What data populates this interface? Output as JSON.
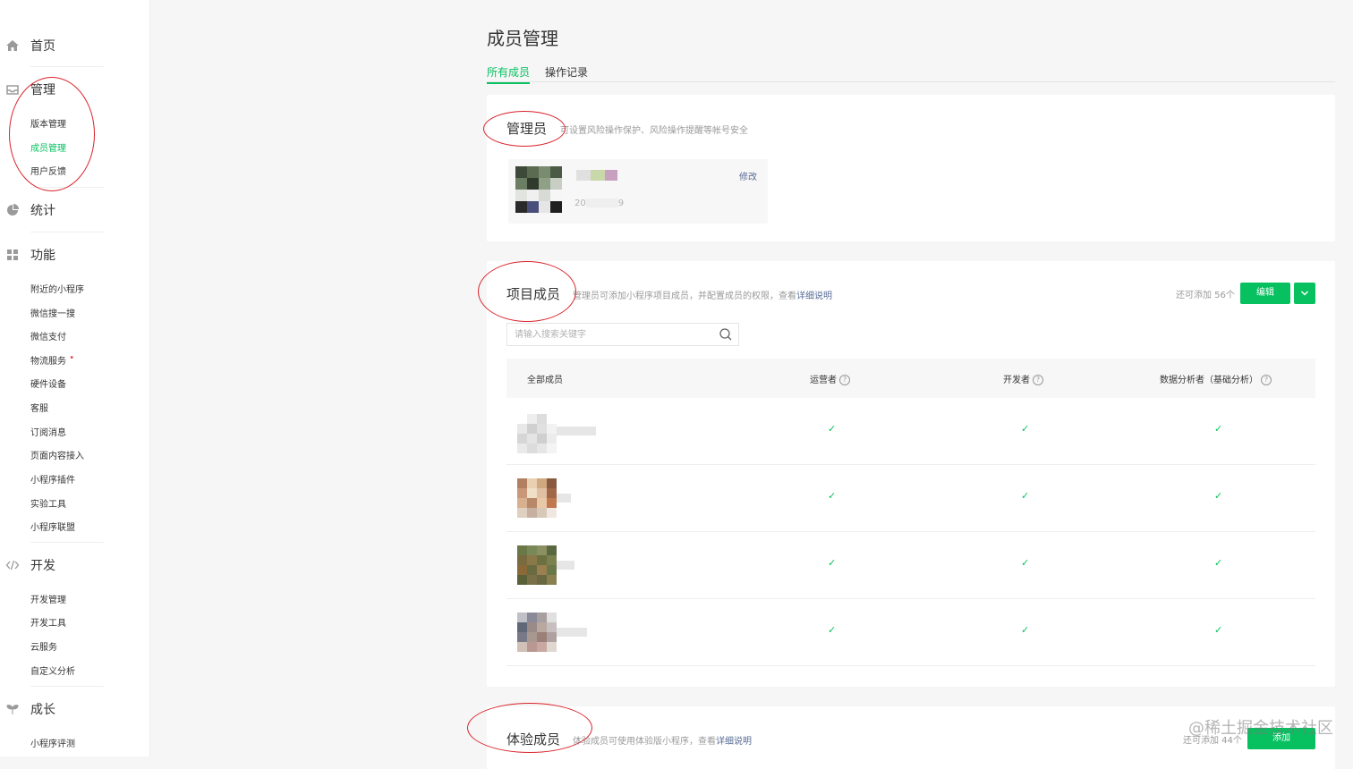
{
  "sidebar": {
    "home": "首页",
    "manage": {
      "label": "管理",
      "items": [
        "版本管理",
        "成员管理",
        "用户反馈"
      ],
      "active_index": 1
    },
    "stats": "统计",
    "features": {
      "label": "功能",
      "items": [
        "附近的小程序",
        "微信搜一搜",
        "微信支付",
        "物流服务",
        "硬件设备",
        "客服",
        "订阅消息",
        "页面内容接入",
        "小程序插件",
        "实验工具",
        "小程序联盟"
      ]
    },
    "dev": {
      "label": "开发",
      "items": [
        "开发管理",
        "开发工具",
        "云服务",
        "自定义分析"
      ]
    },
    "growth": {
      "label": "成长",
      "items": [
        "小程序评测"
      ]
    }
  },
  "page": {
    "title": "成员管理",
    "tabs": [
      "所有成员",
      "操作记录"
    ]
  },
  "admin": {
    "title": "管理员",
    "desc": "可设置风险操作保护、风险操作提醒等帐号安全",
    "edit": "修改",
    "id_prefix": "20",
    "id_suffix": "9"
  },
  "project": {
    "title": "项目成员",
    "desc": "管理员可添加小程序项目成员，并配置成员的权限，查看",
    "desc_link": "详细说明",
    "remaining": "还可添加 56个",
    "edit_btn": "编辑",
    "search_placeholder": "请输入搜索关键字",
    "columns": [
      "全部成员",
      "运营者",
      "开发者",
      "数据分析者（基础分析）"
    ],
    "check": "✓"
  },
  "experience": {
    "title": "体验成员",
    "desc": "体验成员可使用体验版小程序，查看",
    "desc_link": "详细说明",
    "remaining": "还可添加 44个",
    "add_btn": "添加"
  },
  "watermark": "@稀土掘金技术社区",
  "colors": {
    "accent": "#07c160",
    "link": "#576b95",
    "annotation": "#d9222a"
  }
}
